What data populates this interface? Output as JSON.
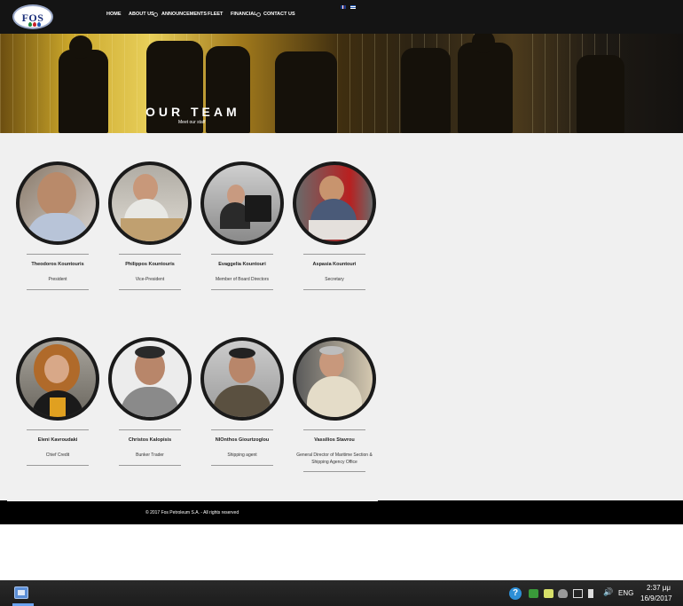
{
  "nav": {
    "items": [
      "HOME",
      "ABOUT US",
      "ANNOUNCEMENTS",
      "FLEET",
      "FINANCIAL",
      "CONTACT US"
    ]
  },
  "logo": {
    "text": "FOS"
  },
  "hero": {
    "title": "OUR TEAM",
    "subtitle": "Meet our staff"
  },
  "team": [
    {
      "name": "Theodoros Kountouris",
      "role": "President"
    },
    {
      "name": "Philippos Kountouris",
      "role": "Vice-President"
    },
    {
      "name": "Evaggelia Kountouri",
      "role": "Member of Board Directors"
    },
    {
      "name": "Aspasia Kountouri",
      "role": "Secretary"
    },
    {
      "name": "Eleni Kavroudaki",
      "role": "Chief Credit"
    },
    {
      "name": "Christos Kalopisis",
      "role": "Bunker Trader"
    },
    {
      "name": "NIOnthos Giourtzoglou",
      "role": "Shipping agent"
    },
    {
      "name": "Vassilios Stavrou",
      "role": "General Director of Maritime Section & Shipping Agency Office"
    }
  ],
  "footer": {
    "text": "© 2017 Fos Petroleum S.A. - All rights reserved"
  },
  "taskbar": {
    "language": "ENG",
    "time": "2:37 μμ",
    "date": "16/9/2017",
    "help_glyph": "?",
    "volume_glyph": "🔊"
  },
  "colors": {
    "header_bg": "#141414",
    "content_bg": "#f0f0f0",
    "footer_bg": "#000000"
  },
  "icons": [
    "help-icon",
    "security-icon",
    "notes-icon",
    "cloud-icon",
    "network-icon",
    "battery-icon",
    "volume-icon",
    "windows-start-icon",
    "flag-en-icon",
    "flag-gr-icon"
  ]
}
